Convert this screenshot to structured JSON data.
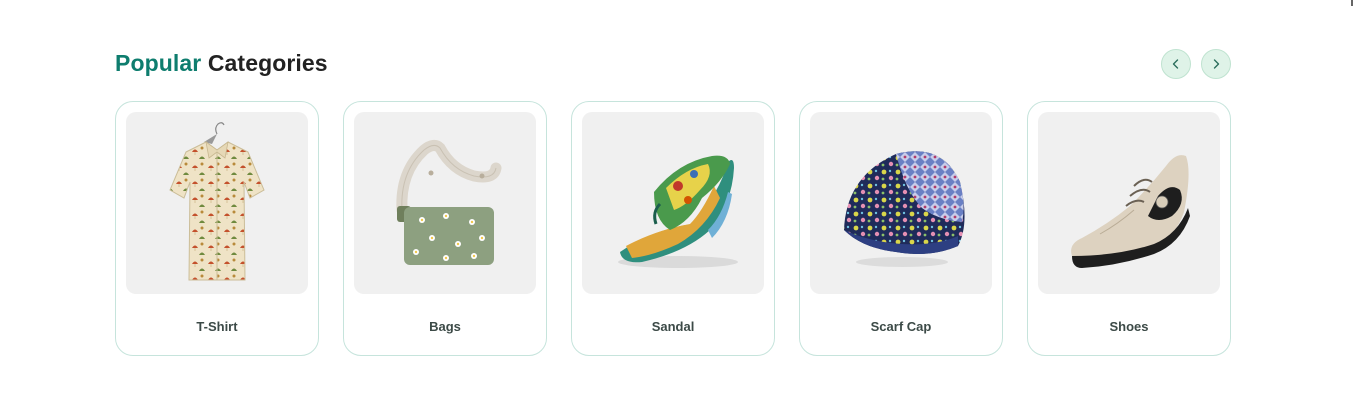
{
  "section": {
    "title_accent": "Popular",
    "title_rest": "Categories"
  },
  "nav": {
    "prev_icon": "chevron-left-icon",
    "next_icon": "chevron-right-icon"
  },
  "colors": {
    "accent": "#0e7d6e",
    "card_border": "#c6e4dc",
    "nav_bg": "#dff3e8"
  },
  "categories": [
    {
      "label": "T-Shirt",
      "image": "shirt-image"
    },
    {
      "label": "Bags",
      "image": "bag-image"
    },
    {
      "label": "Sandal",
      "image": "sandal-image"
    },
    {
      "label": "Scarf Cap",
      "image": "cap-image"
    },
    {
      "label": "Shoes",
      "image": "shoe-image"
    }
  ]
}
